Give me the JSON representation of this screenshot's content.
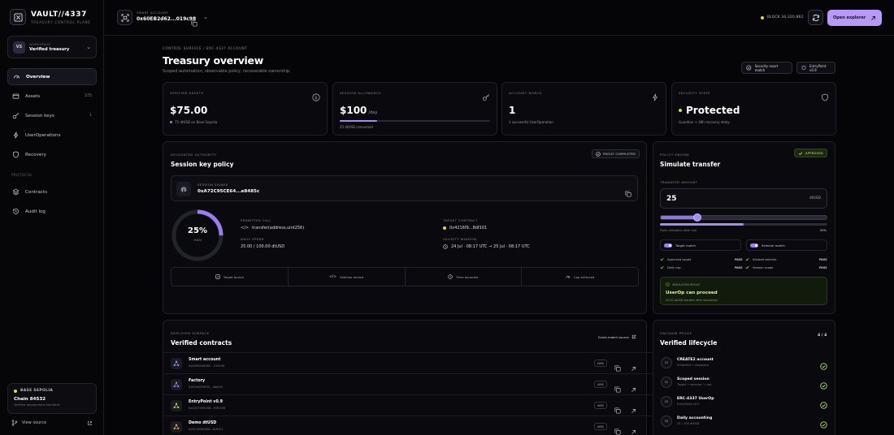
{
  "brand": {
    "title": "VAULT//4337",
    "subtitle": "TREASURY CONTROL PLANE"
  },
  "workspace": {
    "label": "WORKSPACE",
    "name": "Verified treasury",
    "initials": "VS"
  },
  "nav": [
    {
      "label": "Overview",
      "count": "",
      "icon": "dashboard-icon"
    },
    {
      "label": "Assets",
      "count": "575",
      "icon": "wallet-icon"
    },
    {
      "label": "Session keys",
      "count": "1",
      "icon": "key-icon"
    },
    {
      "label": "UserOperations",
      "count": "",
      "icon": "bolt-icon"
    },
    {
      "label": "Recovery",
      "count": "",
      "icon": "shield-icon"
    }
  ],
  "protocol_label": "PROTOCOL",
  "nav2": [
    {
      "label": "Contracts",
      "icon": "layers-icon"
    },
    {
      "label": "Audit log",
      "icon": "history-icon"
    }
  ],
  "chain": {
    "network": "BASE SEPOLIA",
    "name": "Chain 84532",
    "sub": "Verified deployment standard"
  },
  "view_source": "View source",
  "topbar": {
    "acct_label": "SMART ACCOUNT",
    "acct_addr": "0x60EB2d62...019c98",
    "block": "BLOCK 34,320,862",
    "explorer": "Open explorer"
  },
  "page": {
    "breadcrumb": "CONTROL SURFACE / ERC-4337 ACCOUNT",
    "title": "Treasury overview",
    "subtitle": "Scoped automation, observable policy, recoverable ownership."
  },
  "pills": [
    "Security exact match",
    "EntryPoint v0.9"
  ],
  "stats": [
    {
      "label": "VERIFIED ASSETS",
      "value": "$75.00",
      "unit": "",
      "sub": "75 dtUSD on Base Sepolia",
      "icon": "dollar-icon",
      "progress": null
    },
    {
      "label": "SESSION ALLOWANCE",
      "value": "$100",
      "unit": "/day",
      "sub": "25 dtUSD consumed",
      "icon": "key-icon",
      "progress": 0.25
    },
    {
      "label": "ACCOUNT NONCE",
      "value": "1",
      "unit": "",
      "sub": "1 successful UserOperation",
      "icon": "bolt-icon",
      "progress": null
    },
    {
      "label": "SECURITY STATE",
      "value": "Protected",
      "unit": "",
      "sub": "Guardian + 48h recovery delay",
      "icon": "shield-icon",
      "progress": null
    }
  ],
  "session": {
    "label": "DELEGATED AUTHORITY",
    "title": "Session key policy",
    "tag": "PROOF COMPLETED",
    "signer_label": "SESSION SIGNER",
    "signer": "0xA72C95CE64...e8485c",
    "gauge_pct": "25%",
    "gauge_unit": "USED",
    "gauge_fraction": 0.25,
    "permitted_label": "PERMITTED CALL",
    "permitted": "transfer(address,uint256)",
    "target_label": "TARGET CONTRACT",
    "target": "0x4216f9...8df101",
    "daily_label": "DAILY SPEND",
    "daily": "25.00 / 100.00 dtUSD",
    "validity_label": "VALIDITY WINDOW",
    "validity": "24 Jul · 08:17 UTC → 25 Jul · 08:17 UTC",
    "checks": [
      "Target bound",
      "Selector locked",
      "Time bounded",
      "Cap enforced"
    ]
  },
  "policy": {
    "label": "POLICY ENGINE",
    "title": "Simulate transfer",
    "tag": "APPROVED",
    "amount_label": "TRANSFER AMOUNT",
    "amount": "25",
    "unit": "dtUSD",
    "slider_fraction": 0.22,
    "util_fraction": 0.5,
    "util_label": "Daily utilization after call",
    "util_pct": "50%",
    "toggles": [
      "Target match",
      "Selector match"
    ],
    "checklist": [
      {
        "left": "Approved target",
        "right": "Allowed selector"
      },
      {
        "left": "Daily cap",
        "right": "Session scope"
      }
    ],
    "pass": "PASS",
    "verdict_top": "SIMULATION RESULT",
    "verdict": "UserOp can proceed",
    "verdict_sub": "25.00 dtUSD transfer after simulation"
  },
  "contracts": {
    "label": "DEPLOYED SURFACE",
    "title": "Verified contracts",
    "link": "Exact-match source",
    "btn": "ABIS",
    "rows": [
      {
        "name": "Smart account",
        "addr": "0x60EB2d6082...019c98"
      },
      {
        "name": "Factory",
        "addr": "0xB7e62F6f35...4bdf43"
      },
      {
        "name": "EntryPoint v0.9",
        "addr": "0x433709009B...E9D108"
      },
      {
        "name": "Demo dtUSD",
        "addr": "0x4216f9b36D...8df101"
      }
    ]
  },
  "lifecycle": {
    "label": "ONCHAIN PROOF",
    "title": "Verified lifecycle",
    "count": "4 / 4",
    "rows": [
      {
        "num": "01",
        "name": "CREATE2 account",
        "sub": "Predicted + deployed"
      },
      {
        "num": "02",
        "name": "Scoped session",
        "sub": "Target + selector + cap"
      },
      {
        "num": "03",
        "name": "ERC-4337 UserOp",
        "sub": "EntryPoint v0.9"
      },
      {
        "num": "04",
        "name": "Daily accounting",
        "sub": "25 / 100 dtUSD"
      }
    ]
  },
  "colors": {
    "accent": "#b79af7",
    "success": "#b6f04c",
    "warning": "#e7d34a"
  }
}
